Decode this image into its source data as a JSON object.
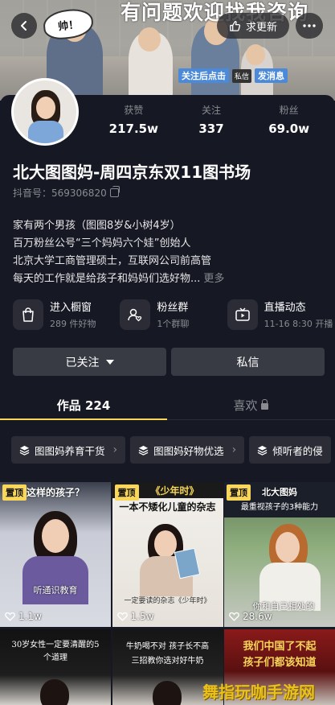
{
  "cover": {
    "banner_text": "有问题欢迎找我咨询",
    "sign_text": "帅！",
    "tag": "私信",
    "cta_left": "关注后点击",
    "cta_right": "发消息"
  },
  "topbar": {
    "update_label": "求更新"
  },
  "stats": [
    {
      "label": "获赞",
      "value": "217.5w"
    },
    {
      "label": "关注",
      "value": "337"
    },
    {
      "label": "粉丝",
      "value": "69.0w"
    }
  ],
  "profile": {
    "name": "北大图图妈-周四京东双11图书场",
    "douyin_id": "抖音号：569306820",
    "bio_lines": [
      "家有两个男孩（图图8岁&小树4岁）",
      "百万粉丝公号“三个妈妈六个娃”创始人",
      "北京大学工商管理硕士，互联网公司前高管",
      "每天的工作就是给孩子和妈妈们选好物..."
    ],
    "bio_more": "更多"
  },
  "features": [
    {
      "title": "进入橱窗",
      "sub": "289 件好物",
      "icon": "shopping-bag-icon"
    },
    {
      "title": "粉丝群",
      "sub": "1个群聊",
      "icon": "fans-group-icon"
    },
    {
      "title": "直播动态",
      "sub": "11-16 8:30 开播",
      "icon": "live-tv-icon"
    }
  ],
  "actions": {
    "follow_label": "已关注",
    "message_label": "私信"
  },
  "tabs": [
    {
      "label": "作品 224",
      "active": true
    },
    {
      "label": "喜欢",
      "active": false
    }
  ],
  "collections": [
    {
      "label": "图图妈养育干货"
    },
    {
      "label": "图图妈好物优选"
    },
    {
      "label": "倾听者的侵"
    }
  ],
  "videos": [
    {
      "pin": "置顶",
      "title": "这样的孩子？",
      "caption": "听通识教育",
      "likes": "1.1w"
    },
    {
      "pin": "置顶",
      "title": "一本不矮化儿童的杂志",
      "banner": "《少年时》",
      "caption": "一定要读的杂志《少年时》",
      "likes": "1.5w"
    },
    {
      "pin": "置顶",
      "title": "北大图妈",
      "subtitle": "最重视孩子的3种能力",
      "caption": "你和自己相处的",
      "likes": "28.6w"
    },
    {
      "title": "30岁女性一定要清醒的5个道理"
    },
    {
      "title": "牛奶喝不对 孩子长不高",
      "subtitle": "三招教你选对好牛奶"
    },
    {
      "title": "我们中国了不起",
      "subtitle": "孩子们都该知道"
    }
  ],
  "watermark": "舞指玩咖手游网",
  "colors": {
    "background": "#161823",
    "accent_yellow": "#f7d65a",
    "button": "#393b44",
    "secondary_text": "#8a8b91"
  }
}
